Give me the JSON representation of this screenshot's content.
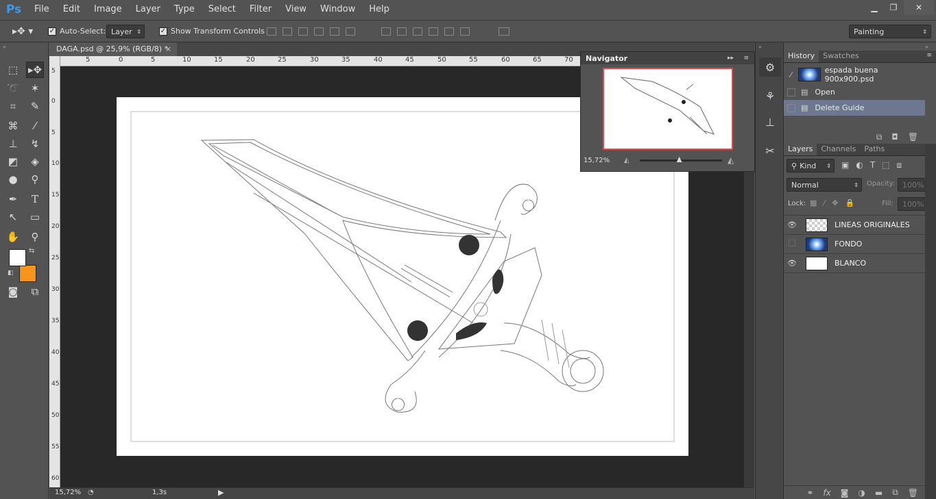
{
  "app": {
    "logo": "Ps"
  },
  "menu": [
    "File",
    "Edit",
    "Image",
    "Layer",
    "Type",
    "Select",
    "Filter",
    "View",
    "Window",
    "Help"
  ],
  "window_controls": {
    "minimize": "▁",
    "restore": "❐",
    "close": "✕"
  },
  "options": {
    "auto_select_label": "Auto-Select:",
    "auto_select_value": "Layer",
    "show_transform_label": "Show Transform Controls",
    "workspace": "Painting"
  },
  "document": {
    "tab_title": "DAGA.psd @ 25,9% (RGB/8) *",
    "tab_close": "×",
    "ruler_h": [
      "5",
      "0",
      "5",
      "10",
      "15",
      "20",
      "25",
      "30",
      "35",
      "40",
      "45",
      "50",
      "55",
      "60",
      "65",
      "70"
    ],
    "ruler_v": [
      "5",
      "0",
      "5",
      "10",
      "15",
      "20",
      "25",
      "30",
      "35",
      "40",
      "45",
      "50",
      "55",
      "60"
    ],
    "zoom": "15,72%",
    "status_info": "1,3s"
  },
  "navigator": {
    "title": "Navigator",
    "zoom": "15,72%",
    "zoom_level": 0.48
  },
  "history": {
    "tabs": [
      "History",
      "Swatches"
    ],
    "snapshot": "espada buena 900x900.psd",
    "items": [
      "Open",
      "Delete Guide"
    ]
  },
  "layers": {
    "tabs": [
      "Layers",
      "Channels",
      "Paths"
    ],
    "filter_kind": "Kind",
    "blend_mode": "Normal",
    "opacity_label": "Opacity:",
    "opacity_value": "100%",
    "lock_label": "Lock:",
    "fill_label": "Fill:",
    "fill_value": "100%",
    "items": [
      {
        "name": "LINEAS ORIGINALES",
        "visible": true
      },
      {
        "name": "FONDO",
        "visible": false
      },
      {
        "name": "BLANCO",
        "visible": true
      }
    ]
  },
  "colors": {
    "foreground": "#ffffff",
    "background": "#f7941d",
    "nav_frame": "#e04b4b"
  }
}
